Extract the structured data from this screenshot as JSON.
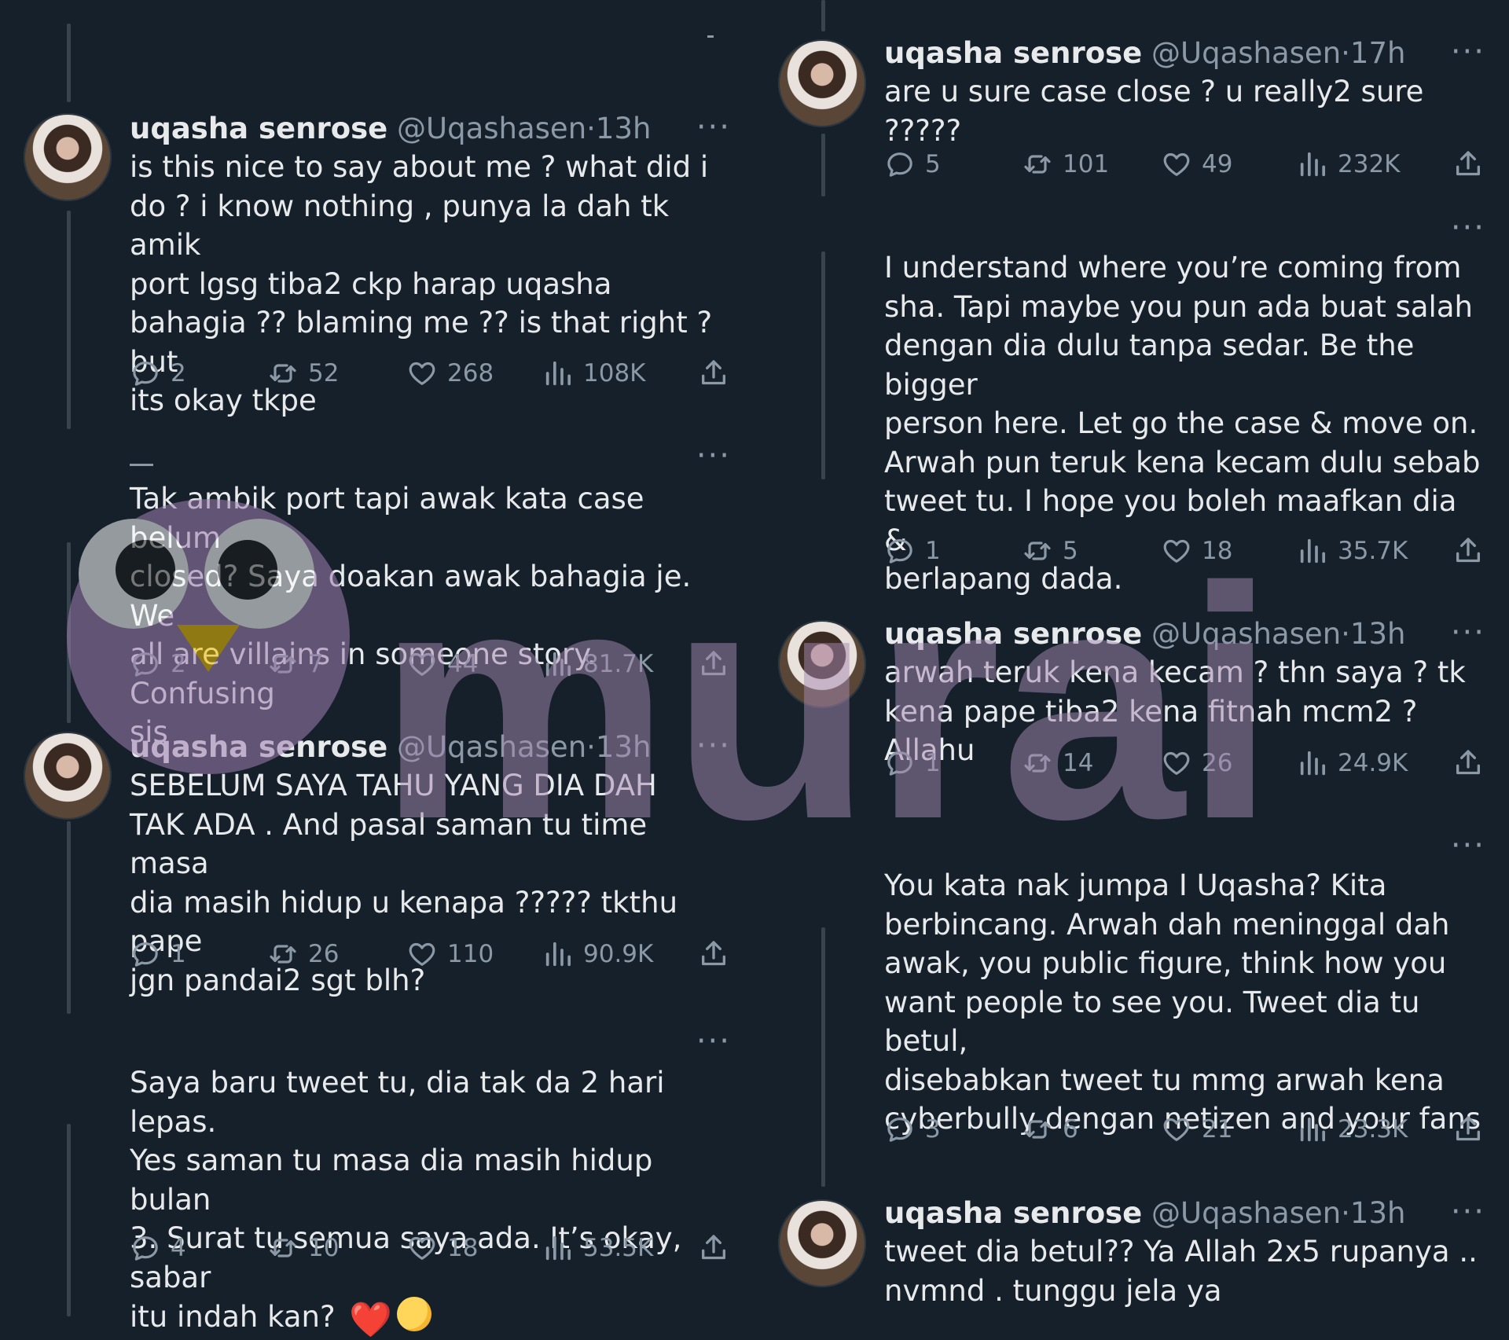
{
  "colors": {
    "background": "#15202b",
    "text": "#e7e9ea",
    "muted": "#8b98a5",
    "heart_emoji": "#e0245e",
    "watermark": "#a78ab3"
  },
  "watermark": {
    "text": "murai",
    "logo": "owl-logo-icon"
  },
  "icons": {
    "reply": "reply-icon",
    "retweet": "retweet-icon",
    "like": "heart-icon",
    "views": "views-chart-icon",
    "share": "share-icon",
    "more": "more-dots-icon"
  },
  "left_column": {
    "tweets": [
      {
        "name": "uqasha senrose",
        "handle": "@Uqashasen",
        "dot": "·",
        "time": "13h",
        "more": "···",
        "text": "is this nice to say about me ? what did i\ndo ? i know nothing , punya la dah tk amik\nport lgsg tiba2 ckp harap uqasha\nbahagia ?? blaming me ?? is that right ? but\nits okay tkpe",
        "replies": "2",
        "retweets": "52",
        "likes": "268",
        "views": "108K"
      },
      {
        "more": "···",
        "text": "Tak ambik port tapi awak kata case belum\nclosed? Saya doakan awak bahagia je. We\nall are villains in someone story. Confusing\nsis",
        "replies": "2",
        "retweets": "7",
        "likes": "44",
        "views": "81.7K"
      },
      {
        "name": "uqasha senrose",
        "handle": "@Uqashasen",
        "dot": "·",
        "time": "13h",
        "more": "···",
        "text": "SEBELUM SAYA TAHU YANG DIA DAH\nTAK ADA . And pasal saman tu time masa\ndia masih hidup u kenapa ????? tkthu pape\njgn pandai2 sgt blh?",
        "replies": "1",
        "retweets": "26",
        "likes": "110",
        "views": "90.9K"
      },
      {
        "more": "···",
        "text": "Saya baru tweet tu, dia tak da 2 hari lepas.\nYes saman tu masa dia masih hidup bulan\n3. Surat tu semua saya ada. It’s okay, sabar\nitu indah kan?",
        "emoji_heart": "❤️",
        "replies": "4",
        "retweets": "10",
        "likes": "18",
        "views": "53.5K"
      }
    ]
  },
  "right_column": {
    "tweets": [
      {
        "name": "uqasha senrose",
        "handle": "@Uqashasen",
        "dot": "·",
        "time": "17h",
        "more": "···",
        "text": "are u sure case close ? u really2 sure ?????",
        "replies": "5",
        "retweets": "101",
        "likes": "49",
        "views": "232K"
      },
      {
        "more": "···",
        "text": "I understand where you’re coming from\nsha. Tapi maybe you pun ada buat salah\ndengan dia dulu tanpa sedar. Be the bigger\nperson here. Let go the case & move on.\nArwah pun teruk kena kecam dulu sebab\ntweet tu. I hope you boleh maafkan dia &\nberlapang dada.",
        "replies": "1",
        "retweets": "5",
        "likes": "18",
        "views": "35.7K"
      },
      {
        "name": "uqasha senrose",
        "handle": "@Uqashasen",
        "dot": "·",
        "time": "13h",
        "more": "···",
        "text": "arwah teruk kena kecam ? thn saya ? tk\nkena pape tiba2 kena fitnah mcm2 ? Allahu",
        "replies": "1",
        "retweets": "14",
        "likes": "26",
        "views": "24.9K"
      },
      {
        "more": "···",
        "text": "You kata nak jumpa I Uqasha? Kita\nberbincang. Arwah dah meninggal dah\nawak, you public figure, think how you\nwant people to see you. Tweet dia tu betul,\ndisebabkan tweet tu mmg arwah kena\ncyberbully dengan netizen and your fans",
        "replies": "3",
        "retweets": "6",
        "likes": "21",
        "views": "23.3K"
      },
      {
        "name": "uqasha senrose",
        "handle": "@Uqashasen",
        "dot": "·",
        "time": "13h",
        "more": "···",
        "text": "tweet dia betul?? Ya Allah 2x5 rupanya ..\nnvmnd . tunggu jela ya"
      }
    ]
  }
}
